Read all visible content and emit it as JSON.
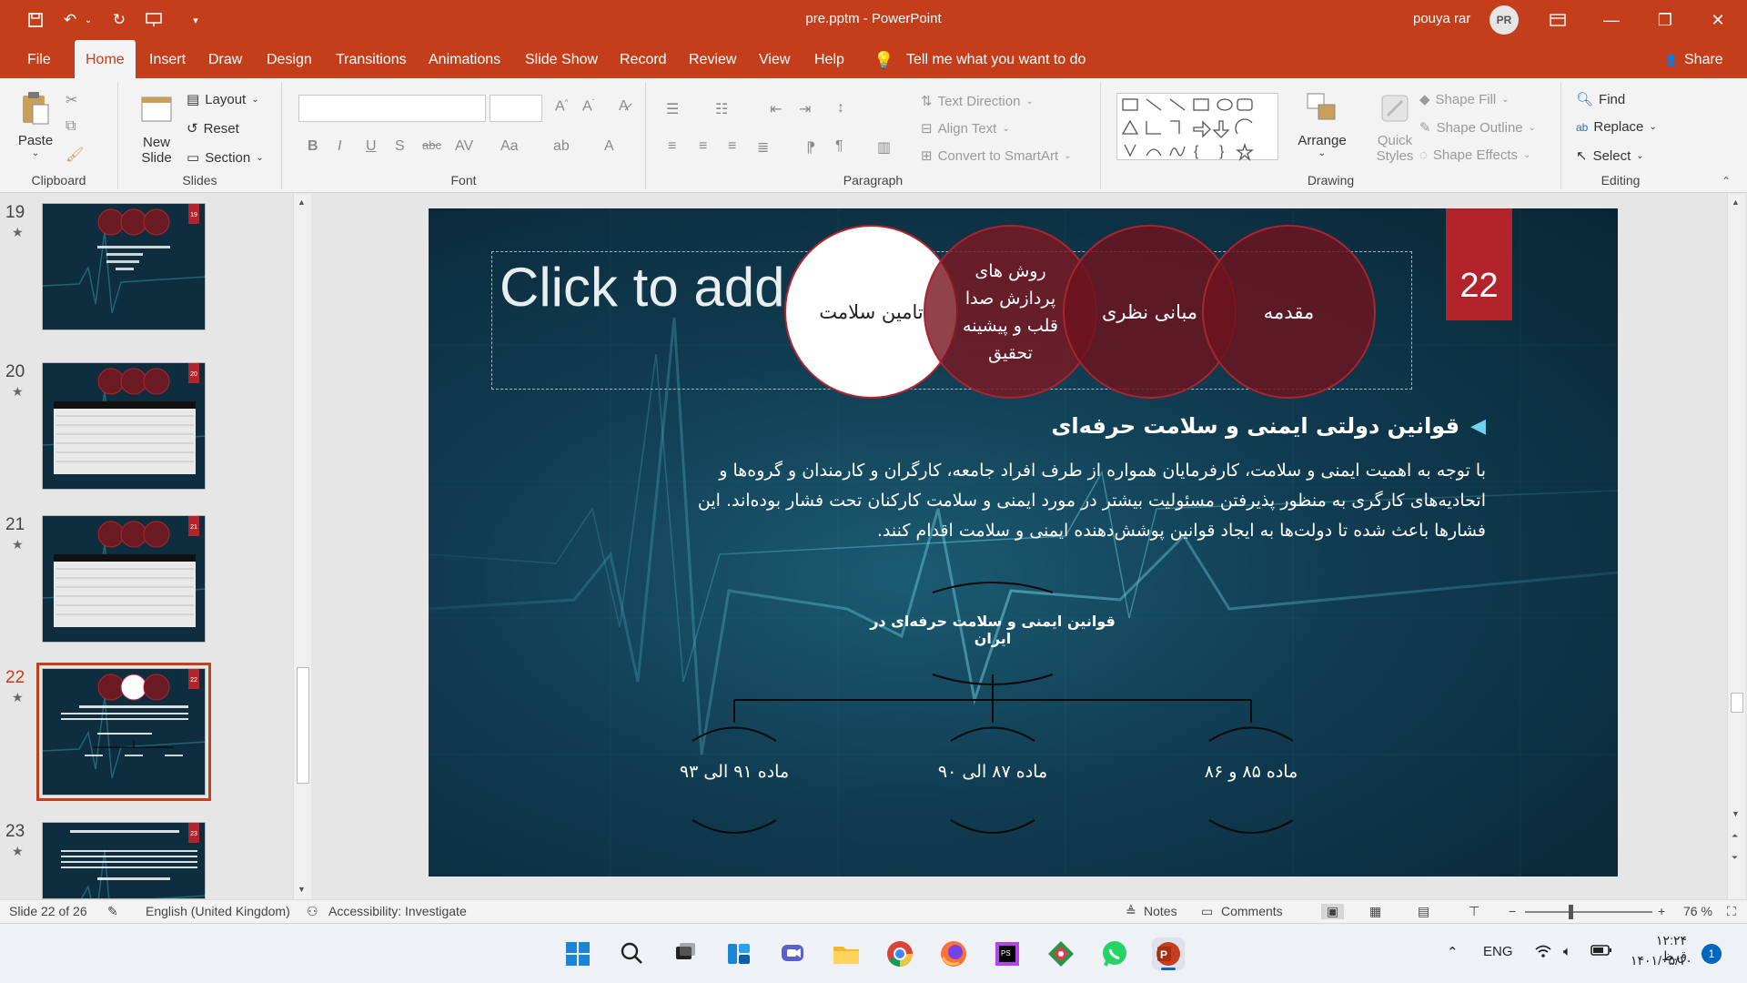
{
  "window": {
    "title": "pre.pptm - PowerPoint",
    "user": "pouya rar",
    "initials": "PR"
  },
  "tabs": [
    {
      "label": "File"
    },
    {
      "label": "Home"
    },
    {
      "label": "Insert"
    },
    {
      "label": "Draw"
    },
    {
      "label": "Design"
    },
    {
      "label": "Transitions"
    },
    {
      "label": "Animations"
    },
    {
      "label": "Slide Show"
    },
    {
      "label": "Record"
    },
    {
      "label": "Review"
    },
    {
      "label": "View"
    },
    {
      "label": "Help"
    }
  ],
  "tell_me": "Tell me what you want to do",
  "share": "Share",
  "ribbon": {
    "clipboard": {
      "label": "Clipboard",
      "paste": "Paste"
    },
    "slides": {
      "label": "Slides",
      "new_slide_1": "New",
      "new_slide_2": "Slide",
      "layout": "Layout",
      "reset": "Reset",
      "section": "Section"
    },
    "font": {
      "label": "Font"
    },
    "paragraph": {
      "label": "Paragraph",
      "text_direction": "Text Direction",
      "align_text": "Align Text",
      "convert_smartart": "Convert to SmartArt"
    },
    "drawing": {
      "label": "Drawing",
      "arrange": "Arrange",
      "quick_styles_1": "Quick",
      "quick_styles_2": "Styles",
      "shape_fill": "Shape Fill",
      "shape_outline": "Shape Outline",
      "shape_effects": "Shape Effects"
    },
    "editing": {
      "label": "Editing",
      "find": "Find",
      "replace": "Replace",
      "select": "Select"
    }
  },
  "thumbnails": [
    {
      "num": "19",
      "badge": "19",
      "selected": false
    },
    {
      "num": "20",
      "badge": "20",
      "selected": false
    },
    {
      "num": "21",
      "badge": "21",
      "selected": false
    },
    {
      "num": "22",
      "badge": "22",
      "selected": true
    },
    {
      "num": "23",
      "badge": "23",
      "selected": false
    }
  ],
  "slide": {
    "number": "22",
    "title_placeholder": "Click to add",
    "nav_circles": [
      "تامین سلامت",
      "روش های پردازش صدا قلب و پیشینه تحقیق",
      "مبانی نظری",
      "مقدمه"
    ],
    "heading": "قوانین دولتی ایمنی و سلامت حرفه‌ای",
    "body": "با توجه به اهمیت ایمنی و سلامت، کارفرمایان همواره از طرف افراد جامعه، کارگران و کارمندان و گروه‌ها و اتحادیه‌های کارگری به منظور پذیرفتن مسئولیت بیشتر در مورد ایمنی و سلامت کارکنان تحت فشار بوده‌اند. این فشارها باعث شده تا دولت‌ها به ایجاد قوانین پوشش‌دهنده ایمنی و سلامت اقدام کنند.",
    "tree_root": "قوانین ایمنی و سلامت حرفه‌ای در ایران",
    "tree_children": [
      "ماده ۹۱ الی ۹۳",
      "ماده ۸۷ الی ۹۰",
      "ماده ۸۵ و ۸۶"
    ]
  },
  "status": {
    "slide_count": "Slide 22 of 26",
    "language": "English (United Kingdom)",
    "accessibility": "Accessibility: Investigate",
    "notes": "Notes",
    "comments": "Comments",
    "zoom": "76 %"
  },
  "taskbar": {
    "lang": "ENG",
    "time": "۱۲:۲۴ ق.ظ",
    "date": "۱۴۰۱/۰۵/۱۰",
    "notif": "1"
  },
  "colors": {
    "accent": "#c43e1c",
    "slide_red": "#b3232b",
    "circle": "#6b1a24"
  }
}
